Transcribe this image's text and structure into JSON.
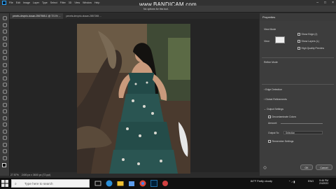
{
  "watermark": "www.BANDICAM.com",
  "app": {
    "logo_label": "Ps",
    "menus": [
      "File",
      "Edit",
      "Image",
      "Layer",
      "Type",
      "Select",
      "Filter",
      "3D",
      "View",
      "Window",
      "Help"
    ],
    "notice": "No options for this tool."
  },
  "tabs": [
    {
      "label": "pexels-devprio-dusan-2567565-1 @ 72.1% ...",
      "active": true
    },
    {
      "label": "pexels-devprio-dusan-2857265 ...",
      "active": false
    }
  ],
  "status": {
    "zoom": "27.57%",
    "doc": "2400 px x 3600 px (72 ppi)"
  },
  "properties": {
    "title": "Properties",
    "view_mode": "View Mode",
    "view_label": "View:",
    "show_edges": "Show Edge (J)",
    "show_layers": "Show Layers (L)",
    "high_quality": "High Quality Preview",
    "refine_mode": "Refine Mode",
    "edge_detection": "Edge Detection",
    "global_refinements": "Global Refinements",
    "output_settings": "Output Settings",
    "decontaminate": "Decontaminate Colors",
    "amount": "Amount:",
    "output_to": "Output To:",
    "output_value": "Selection",
    "remember": "Remember Settings",
    "ok": "OK",
    "cancel": "Cancel"
  },
  "taskbar": {
    "search_placeholder": "Type here to search",
    "weather": "84°F Partly cloudy",
    "time": "9:46 PM",
    "date": "2/4/2022",
    "lang": "ENG"
  },
  "colors": {
    "accent": "#31a8ff",
    "panel": "#3d3d3d",
    "taskbar": "#101010"
  }
}
